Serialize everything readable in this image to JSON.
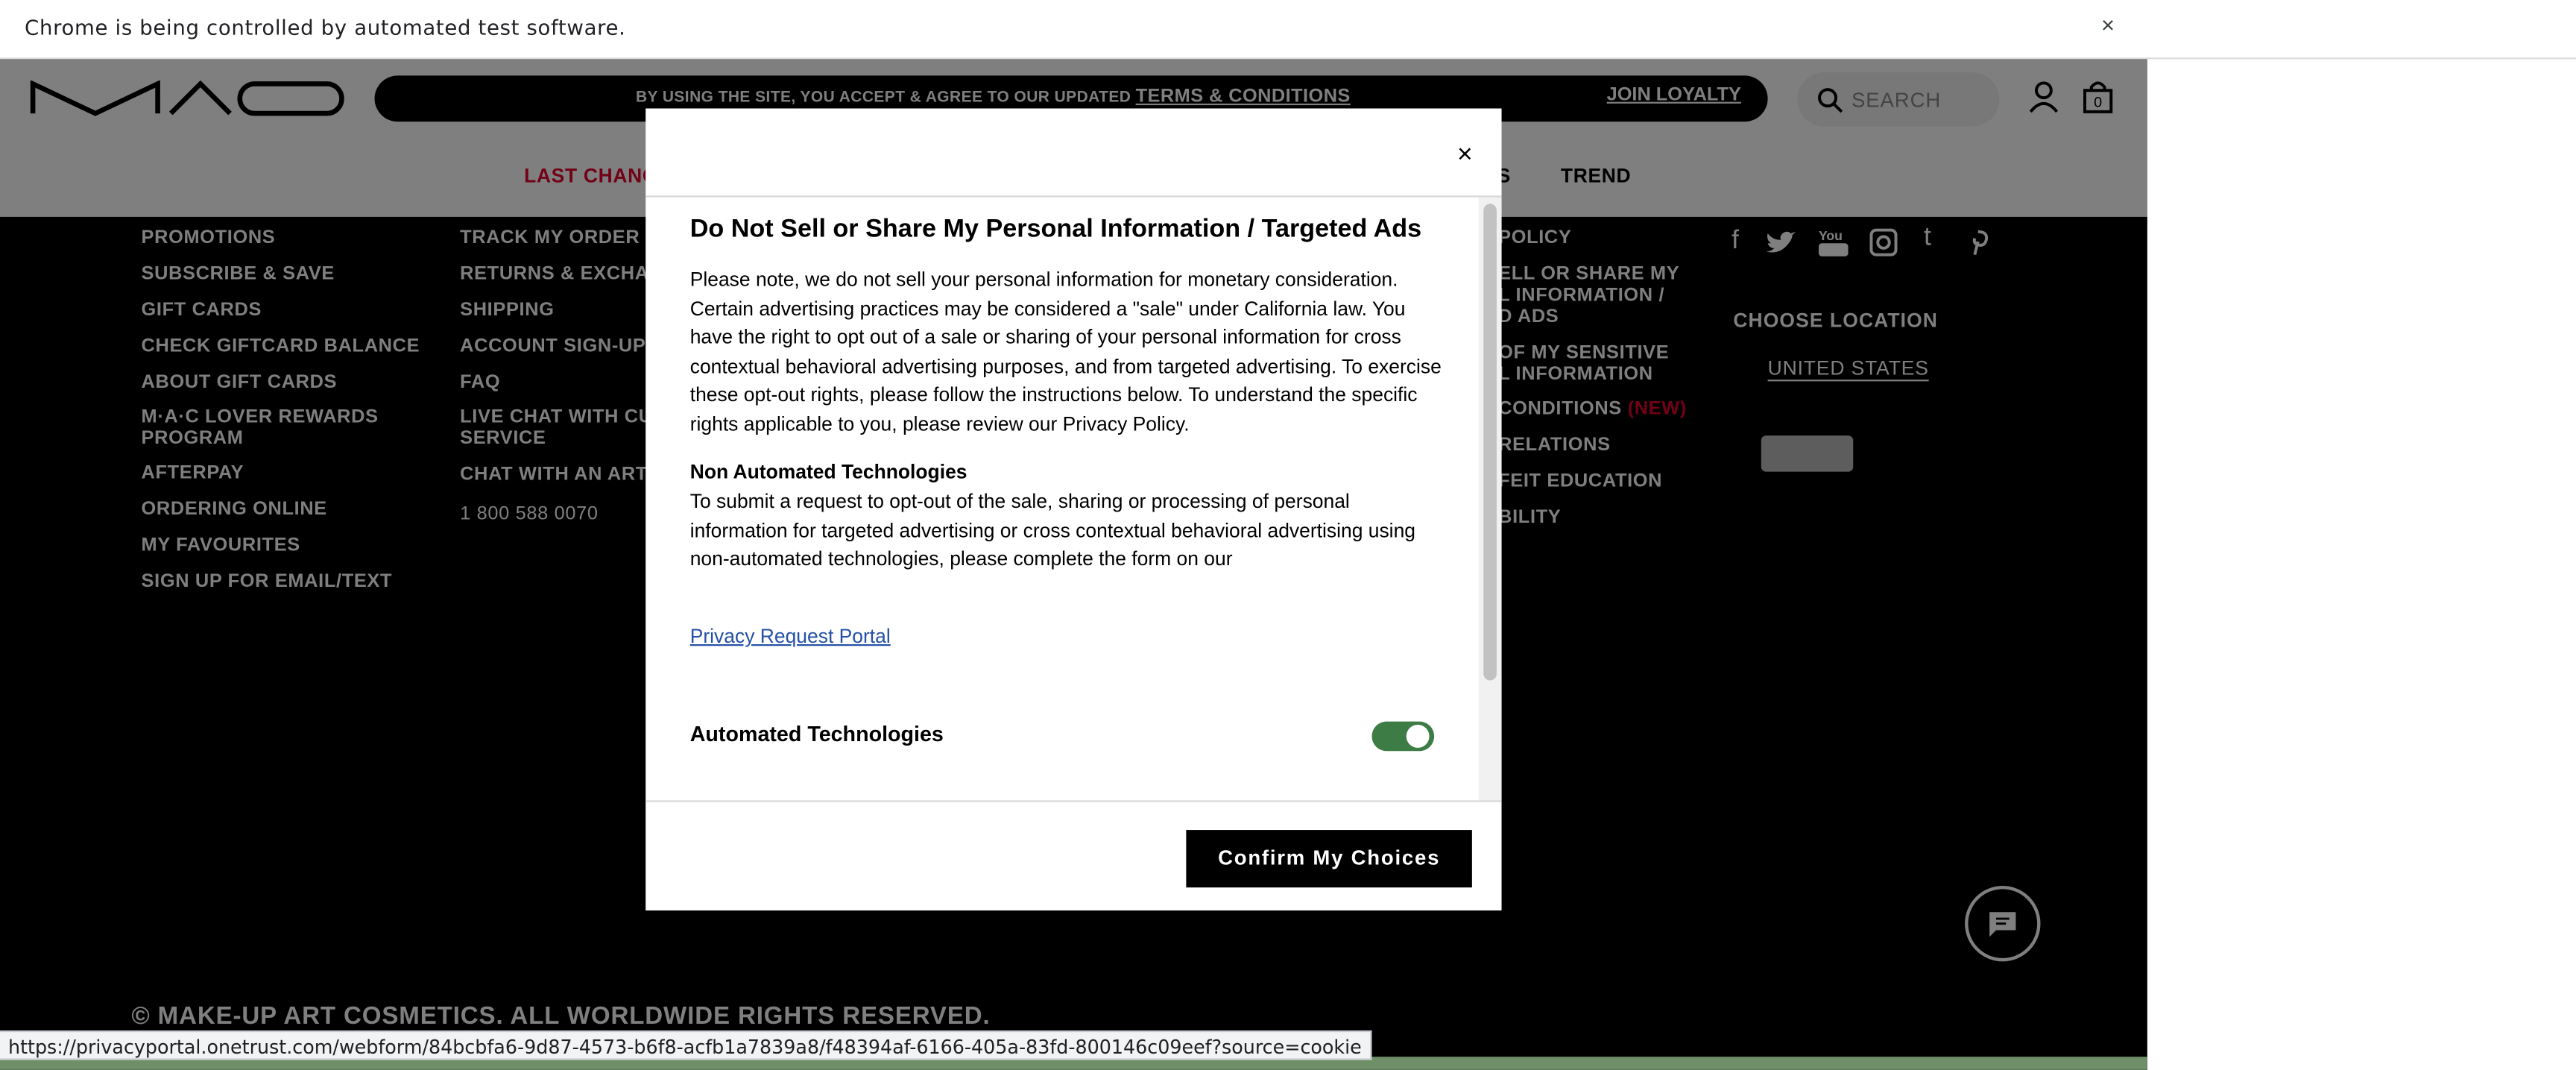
{
  "infobar": {
    "message": "Chrome is being controlled by automated test software.",
    "close": "×"
  },
  "header": {
    "promo_text": "BY USING THE SITE, YOU ACCEPT & AGREE TO OUR UPDATED",
    "promo_link": "TERMS & CONDITIONS",
    "join_loyalty": "JOIN LOYALTY",
    "search_placeholder": "SEARCH",
    "bag_count": "0",
    "nav": [
      {
        "label": "LAST CHANC",
        "color": "#e4032e"
      },
      {
        "label": "ES"
      },
      {
        "label": "TREND"
      }
    ]
  },
  "footer": {
    "col1": [
      "PROMOTIONS",
      "SUBSCRIBE & SAVE",
      "GIFT CARDS",
      "CHECK GIFTCARD BALANCE",
      "ABOUT GIFT CARDS",
      "M·A·C LOVER REWARDS",
      "PROGRAM",
      "AFTERPAY",
      "ORDERING ONLINE",
      "MY FAVOURITES",
      "SIGN UP FOR EMAIL/TEXT"
    ],
    "col2": [
      "TRACK MY ORDER",
      "RETURNS & EXCHANG",
      "SHIPPING",
      "ACCOUNT SIGN-UP",
      "FAQ",
      "LIVE CHAT WITH CUS",
      "SERVICE",
      "CHAT WITH AN ARTIS",
      "1 800 588 0070"
    ],
    "col3": [
      "POLICY",
      "ELL OR SHARE MY",
      "L INFORMATION /",
      "D ADS",
      "OF MY SENSITIVE",
      "L INFORMATION",
      "CONDITIONS",
      "(NEW)",
      "RELATIONS",
      "FEIT EDUCATION",
      "BILITY"
    ],
    "choose_location": "CHOOSE LOCATION",
    "location_value": "UNITED STATES",
    "copyright": "© MAKE-UP ART COSMETICS. ALL WORLDWIDE RIGHTS RESERVED."
  },
  "modal": {
    "close": "×",
    "title": "Do Not Sell or Share My Personal Information / Targeted Ads",
    "body": "Please note, we do not sell your personal information for monetary consideration. Certain advertising practices may be considered a \"sale\" under California law. You have the right to opt out of a sale or sharing of your personal information for cross contextual behavioral advertising purposes, and from targeted advertising. To exercise these opt-out rights, please follow the instructions below. To understand the specific rights applicable to you, please review our Privacy Policy.",
    "sub_heading": "Non Automated Technologies",
    "sub_body": "To submit a request to opt-out of the sale, sharing or processing of personal information for targeted advertising or cross contextual behavioral advertising using non-automated technologies, please complete the form on our",
    "portal_link": "Privacy Request Portal",
    "toggle_label": "Automated Technologies",
    "toggle_on": true,
    "confirm": "Confirm My Choices"
  },
  "status_url": "https://privacyportal.onetrust.com/webform/84bcbfa6-9d87-4573-b6f8-acfb1a7839a8/f48394af-6166-405a-83fd-800146c09eef?source=cookie",
  "colors": {
    "accent_red": "#e4032e",
    "toggle_green": "#3d7d45",
    "link_blue": "#2451a6"
  }
}
